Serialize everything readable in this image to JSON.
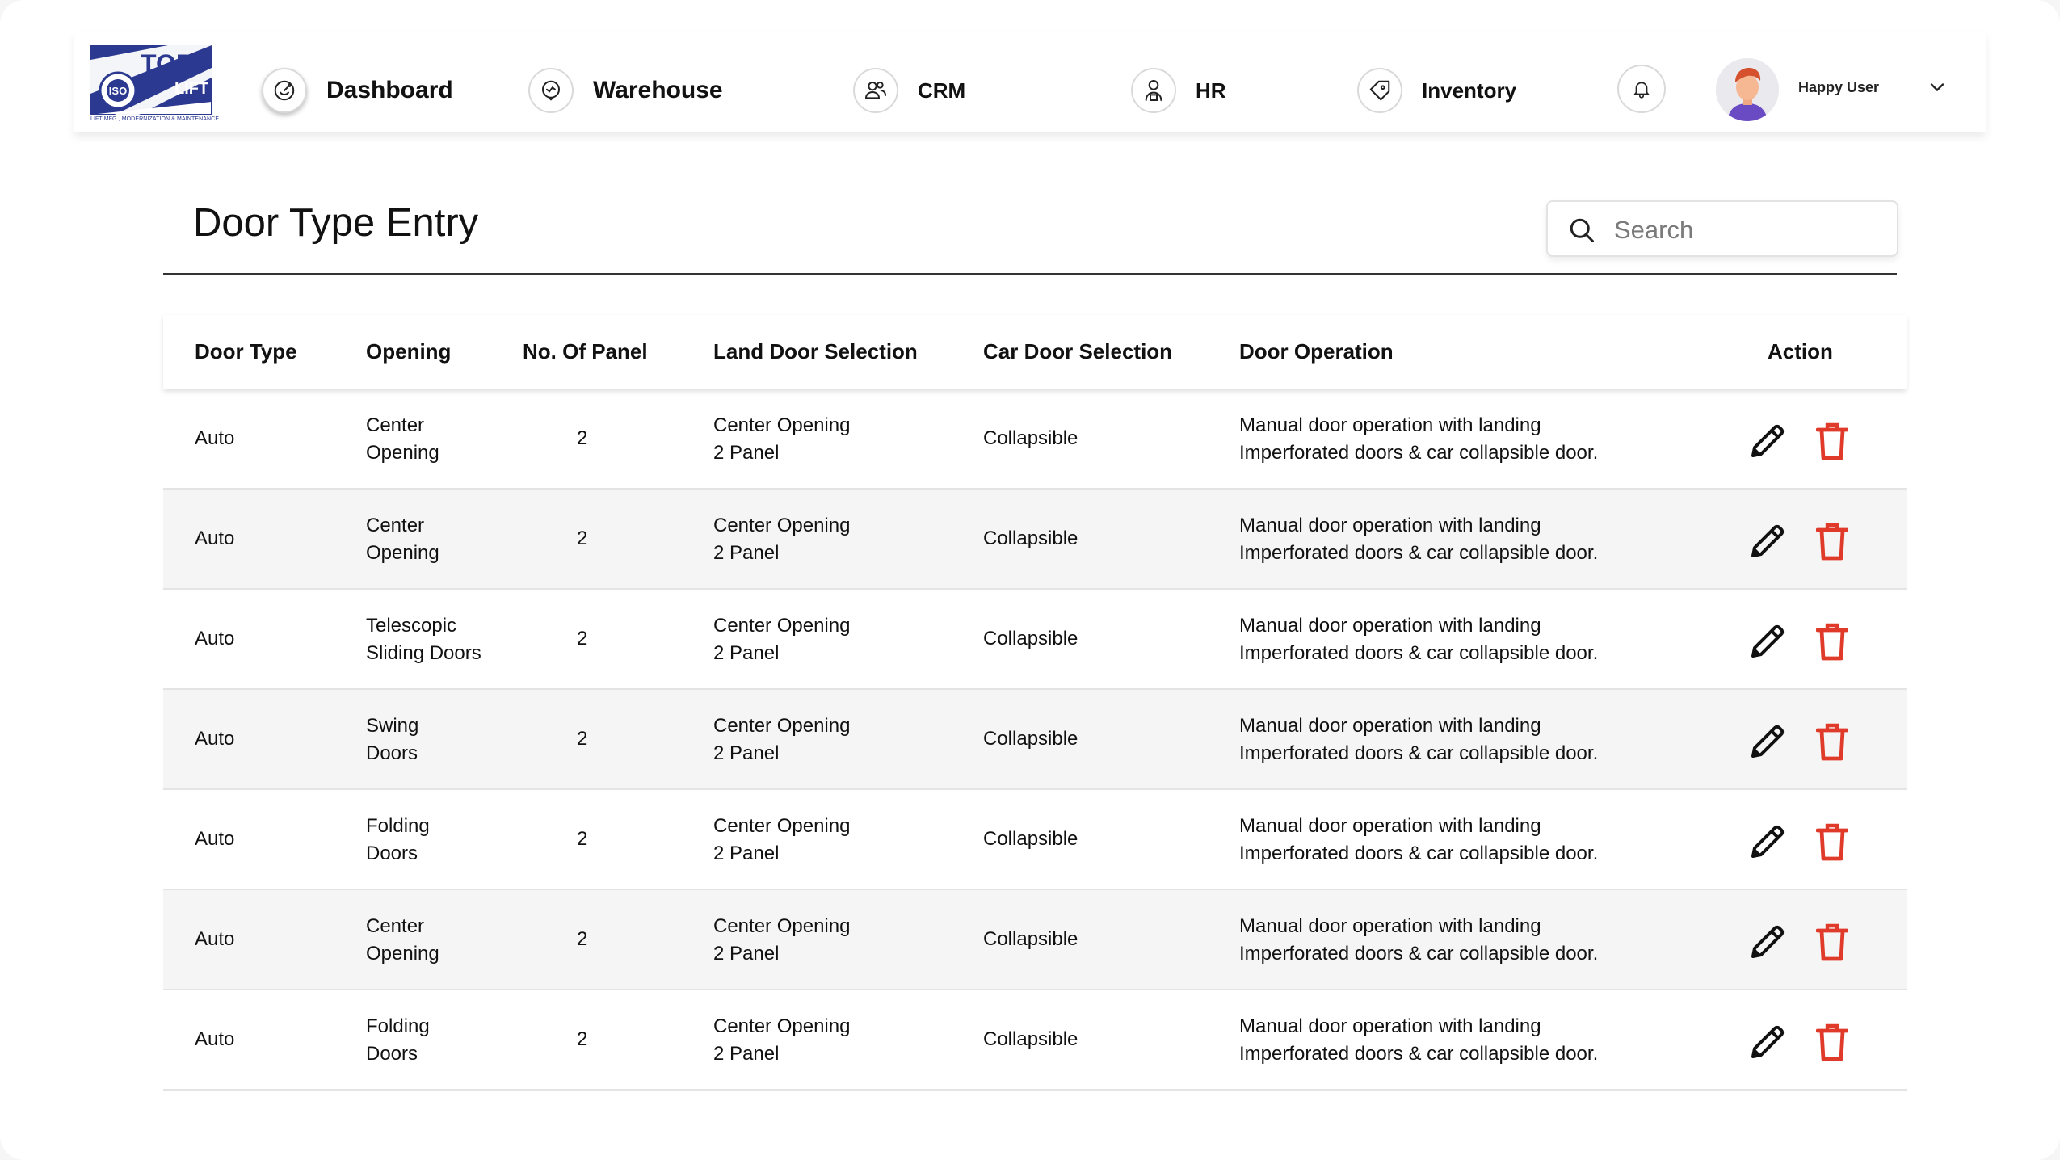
{
  "brand": {
    "logo_text_top": "TOP",
    "logo_text_lift": "LIFT",
    "logo_badge": "ISO",
    "logo_tagline": "LIFT MFG., MODERNIZATION & MAINTENANCE",
    "brand_color": "#2b3990"
  },
  "nav": {
    "dashboard": "Dashboard",
    "warehouse": "Warehouse",
    "crm": "CRM",
    "hr": "HR",
    "inventory": "Inventory"
  },
  "user": {
    "name": "Happy User"
  },
  "page": {
    "title": "Door Type Entry"
  },
  "search": {
    "placeholder": "Search"
  },
  "colors": {
    "delete": "#e03a2a",
    "row_alt": "#f5f5f5"
  },
  "table": {
    "headers": {
      "door_type": "Door Type",
      "opening": "Opening",
      "panels": "No. Of Panel",
      "land_door": "Land Door Selection",
      "car_door": "Car Door Selection",
      "operation": "Door Operation",
      "action": "Action"
    },
    "rows": [
      {
        "door_type": "Auto",
        "opening": [
          "Center",
          "Opening"
        ],
        "panels": "2",
        "land_door": [
          "Center Opening",
          "2 Panel"
        ],
        "car_door": "Collapsible",
        "operation": [
          "Manual door operation with landing",
          "Imperforated doors  & car collapsible door."
        ]
      },
      {
        "door_type": "Auto",
        "opening": [
          "Center",
          "Opening"
        ],
        "panels": "2",
        "land_door": [
          "Center Opening",
          "2 Panel"
        ],
        "car_door": "Collapsible",
        "operation": [
          "Manual door operation with landing",
          "Imperforated doors  & car collapsible door."
        ]
      },
      {
        "door_type": "Auto",
        "opening": [
          "Telescopic",
          "Sliding Doors"
        ],
        "panels": "2",
        "land_door": [
          "Center Opening",
          "2 Panel"
        ],
        "car_door": "Collapsible",
        "operation": [
          "Manual door operation with landing",
          "Imperforated doors  & car collapsible door."
        ]
      },
      {
        "door_type": "Auto",
        "opening": [
          "Swing",
          "Doors"
        ],
        "panels": "2",
        "land_door": [
          "Center Opening",
          "2 Panel"
        ],
        "car_door": "Collapsible",
        "operation": [
          "Manual door operation with landing",
          "Imperforated doors  & car collapsible door."
        ]
      },
      {
        "door_type": "Auto",
        "opening": [
          "Folding",
          "Doors"
        ],
        "panels": "2",
        "land_door": [
          "Center Opening",
          "2 Panel"
        ],
        "car_door": "Collapsible",
        "operation": [
          "Manual door operation with landing",
          "Imperforated doors  & car collapsible door."
        ]
      },
      {
        "door_type": "Auto",
        "opening": [
          "Center",
          "Opening"
        ],
        "panels": "2",
        "land_door": [
          "Center Opening",
          "2 Panel"
        ],
        "car_door": "Collapsible",
        "operation": [
          "Manual door operation with landing",
          "Imperforated doors  & car collapsible door."
        ]
      },
      {
        "door_type": "Auto",
        "opening": [
          "Folding",
          "Doors"
        ],
        "panels": "2",
        "land_door": [
          "Center Opening",
          "2 Panel"
        ],
        "car_door": "Collapsible",
        "operation": [
          "Manual door operation with landing",
          "Imperforated doors  & car collapsible door."
        ]
      }
    ]
  }
}
